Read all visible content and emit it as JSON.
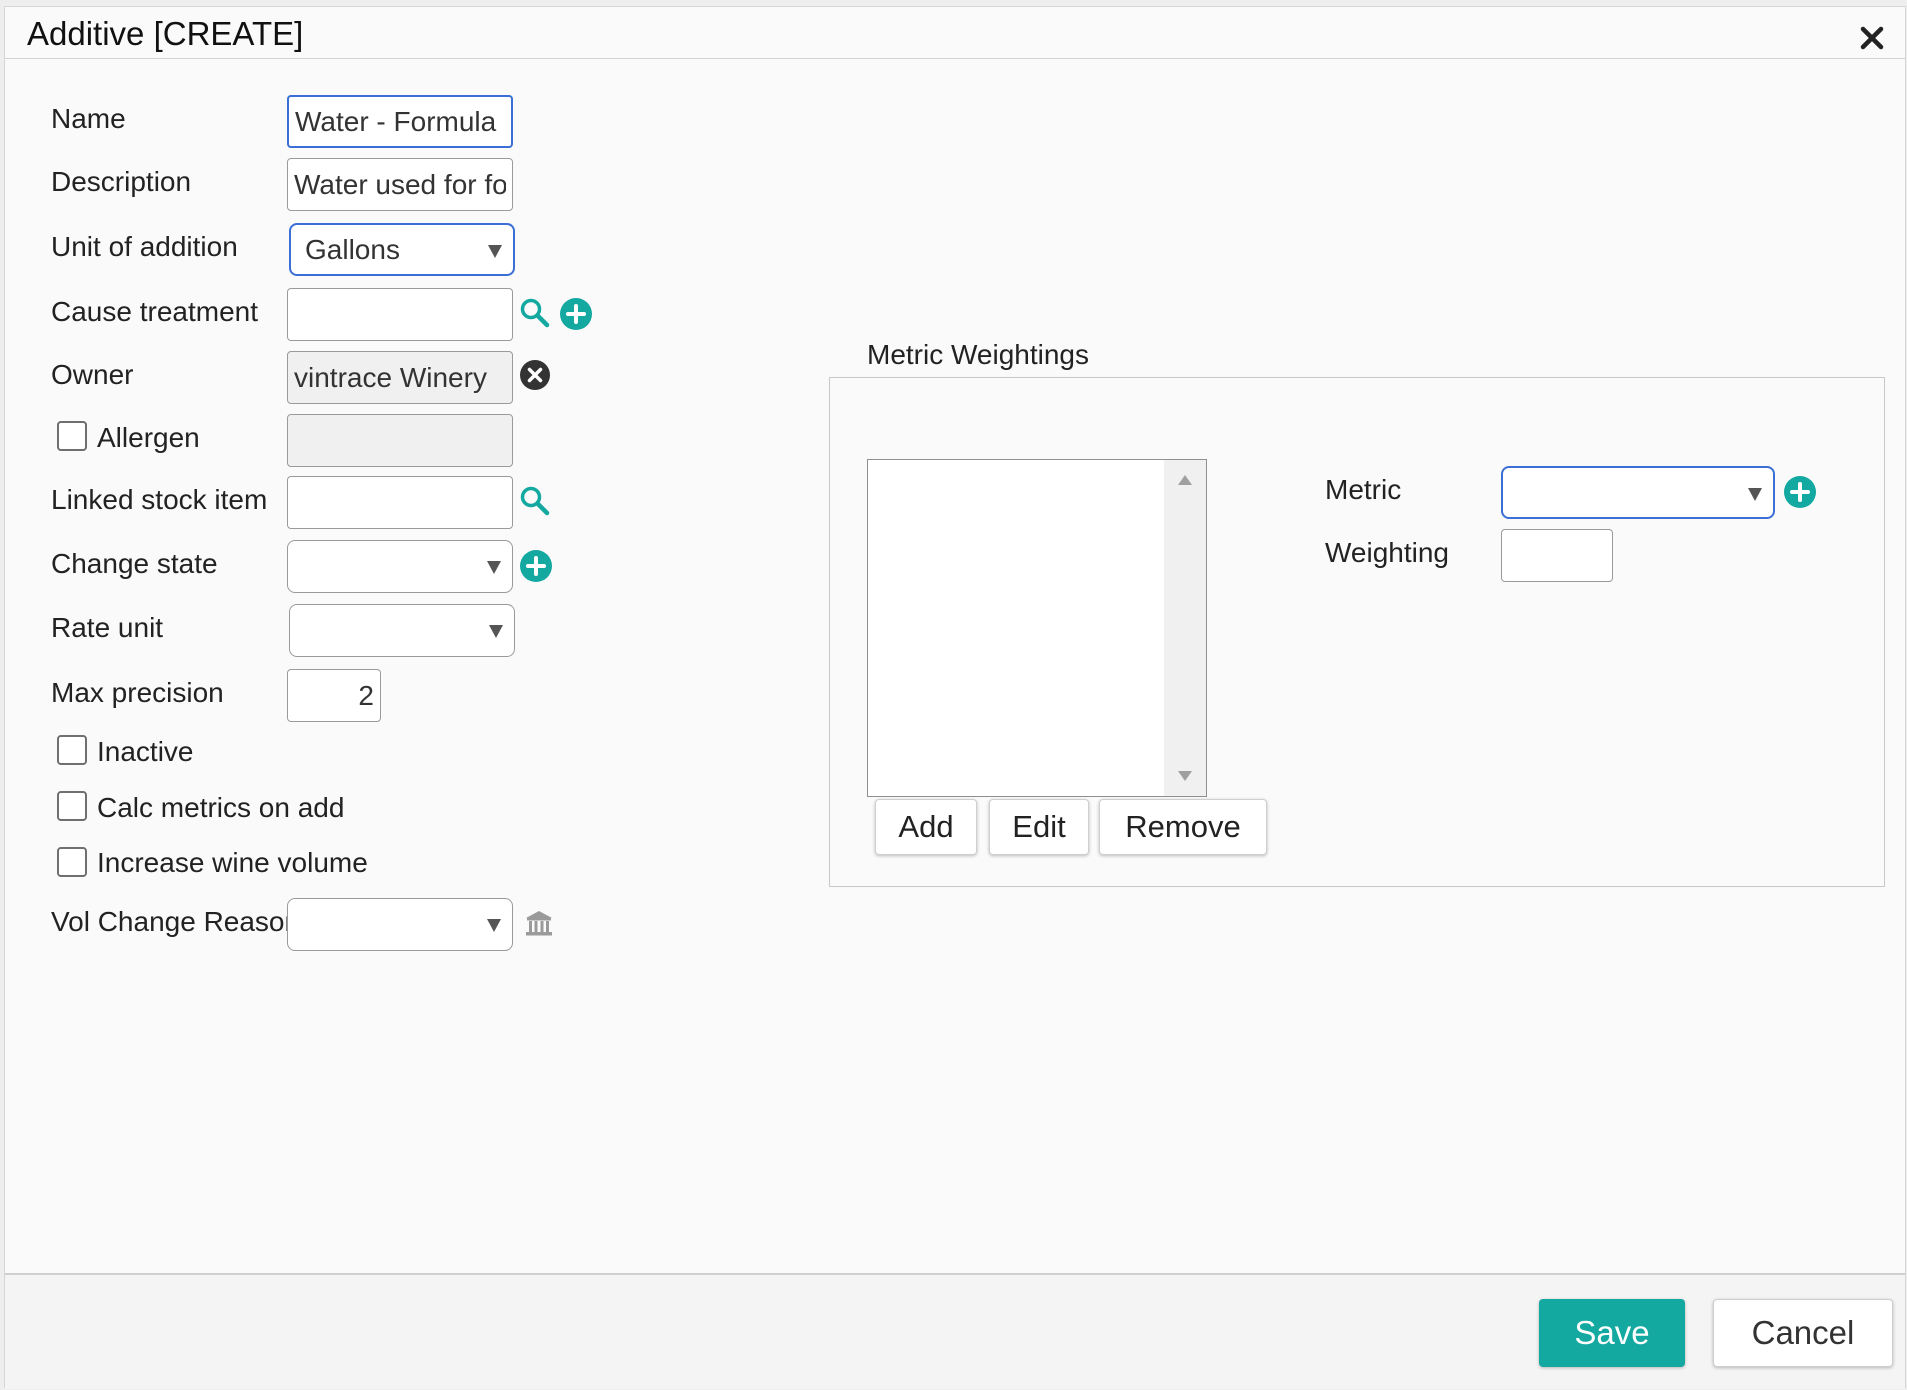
{
  "dialog": {
    "title": "Additive [CREATE]"
  },
  "form": {
    "name": {
      "label": "Name",
      "value": "Water - Formula"
    },
    "description": {
      "label": "Description",
      "value": "Water used for form"
    },
    "unit_of_addition": {
      "label": "Unit of addition",
      "value": "Gallons"
    },
    "cause_treatment": {
      "label": "Cause treatment",
      "value": ""
    },
    "owner": {
      "label": "Owner",
      "value": "vintrace Winery"
    },
    "allergen": {
      "label": "Allergen",
      "checked": false,
      "value": ""
    },
    "linked_stock_item": {
      "label": "Linked stock item",
      "value": ""
    },
    "change_state": {
      "label": "Change state",
      "value": ""
    },
    "rate_unit": {
      "label": "Rate unit",
      "value": ""
    },
    "max_precision": {
      "label": "Max precision",
      "value": "2"
    },
    "inactive": {
      "label": "Inactive",
      "checked": false
    },
    "calc_metrics_on_add": {
      "label": "Calc metrics on add",
      "checked": false
    },
    "increase_wine_volume": {
      "label": "Increase wine volume",
      "checked": false
    },
    "vol_change_reason": {
      "label": "Vol Change Reason",
      "value": ""
    }
  },
  "metric_weightings": {
    "title": "Metric Weightings",
    "items": [],
    "buttons": {
      "add": "Add",
      "edit": "Edit",
      "remove": "Remove"
    },
    "metric": {
      "label": "Metric",
      "value": ""
    },
    "weighting": {
      "label": "Weighting",
      "value": ""
    }
  },
  "footer": {
    "save": "Save",
    "cancel": "Cancel"
  },
  "colors": {
    "accent": "#13a8a0",
    "focus_border": "#3b6fd6",
    "clear_icon": "#333333"
  }
}
